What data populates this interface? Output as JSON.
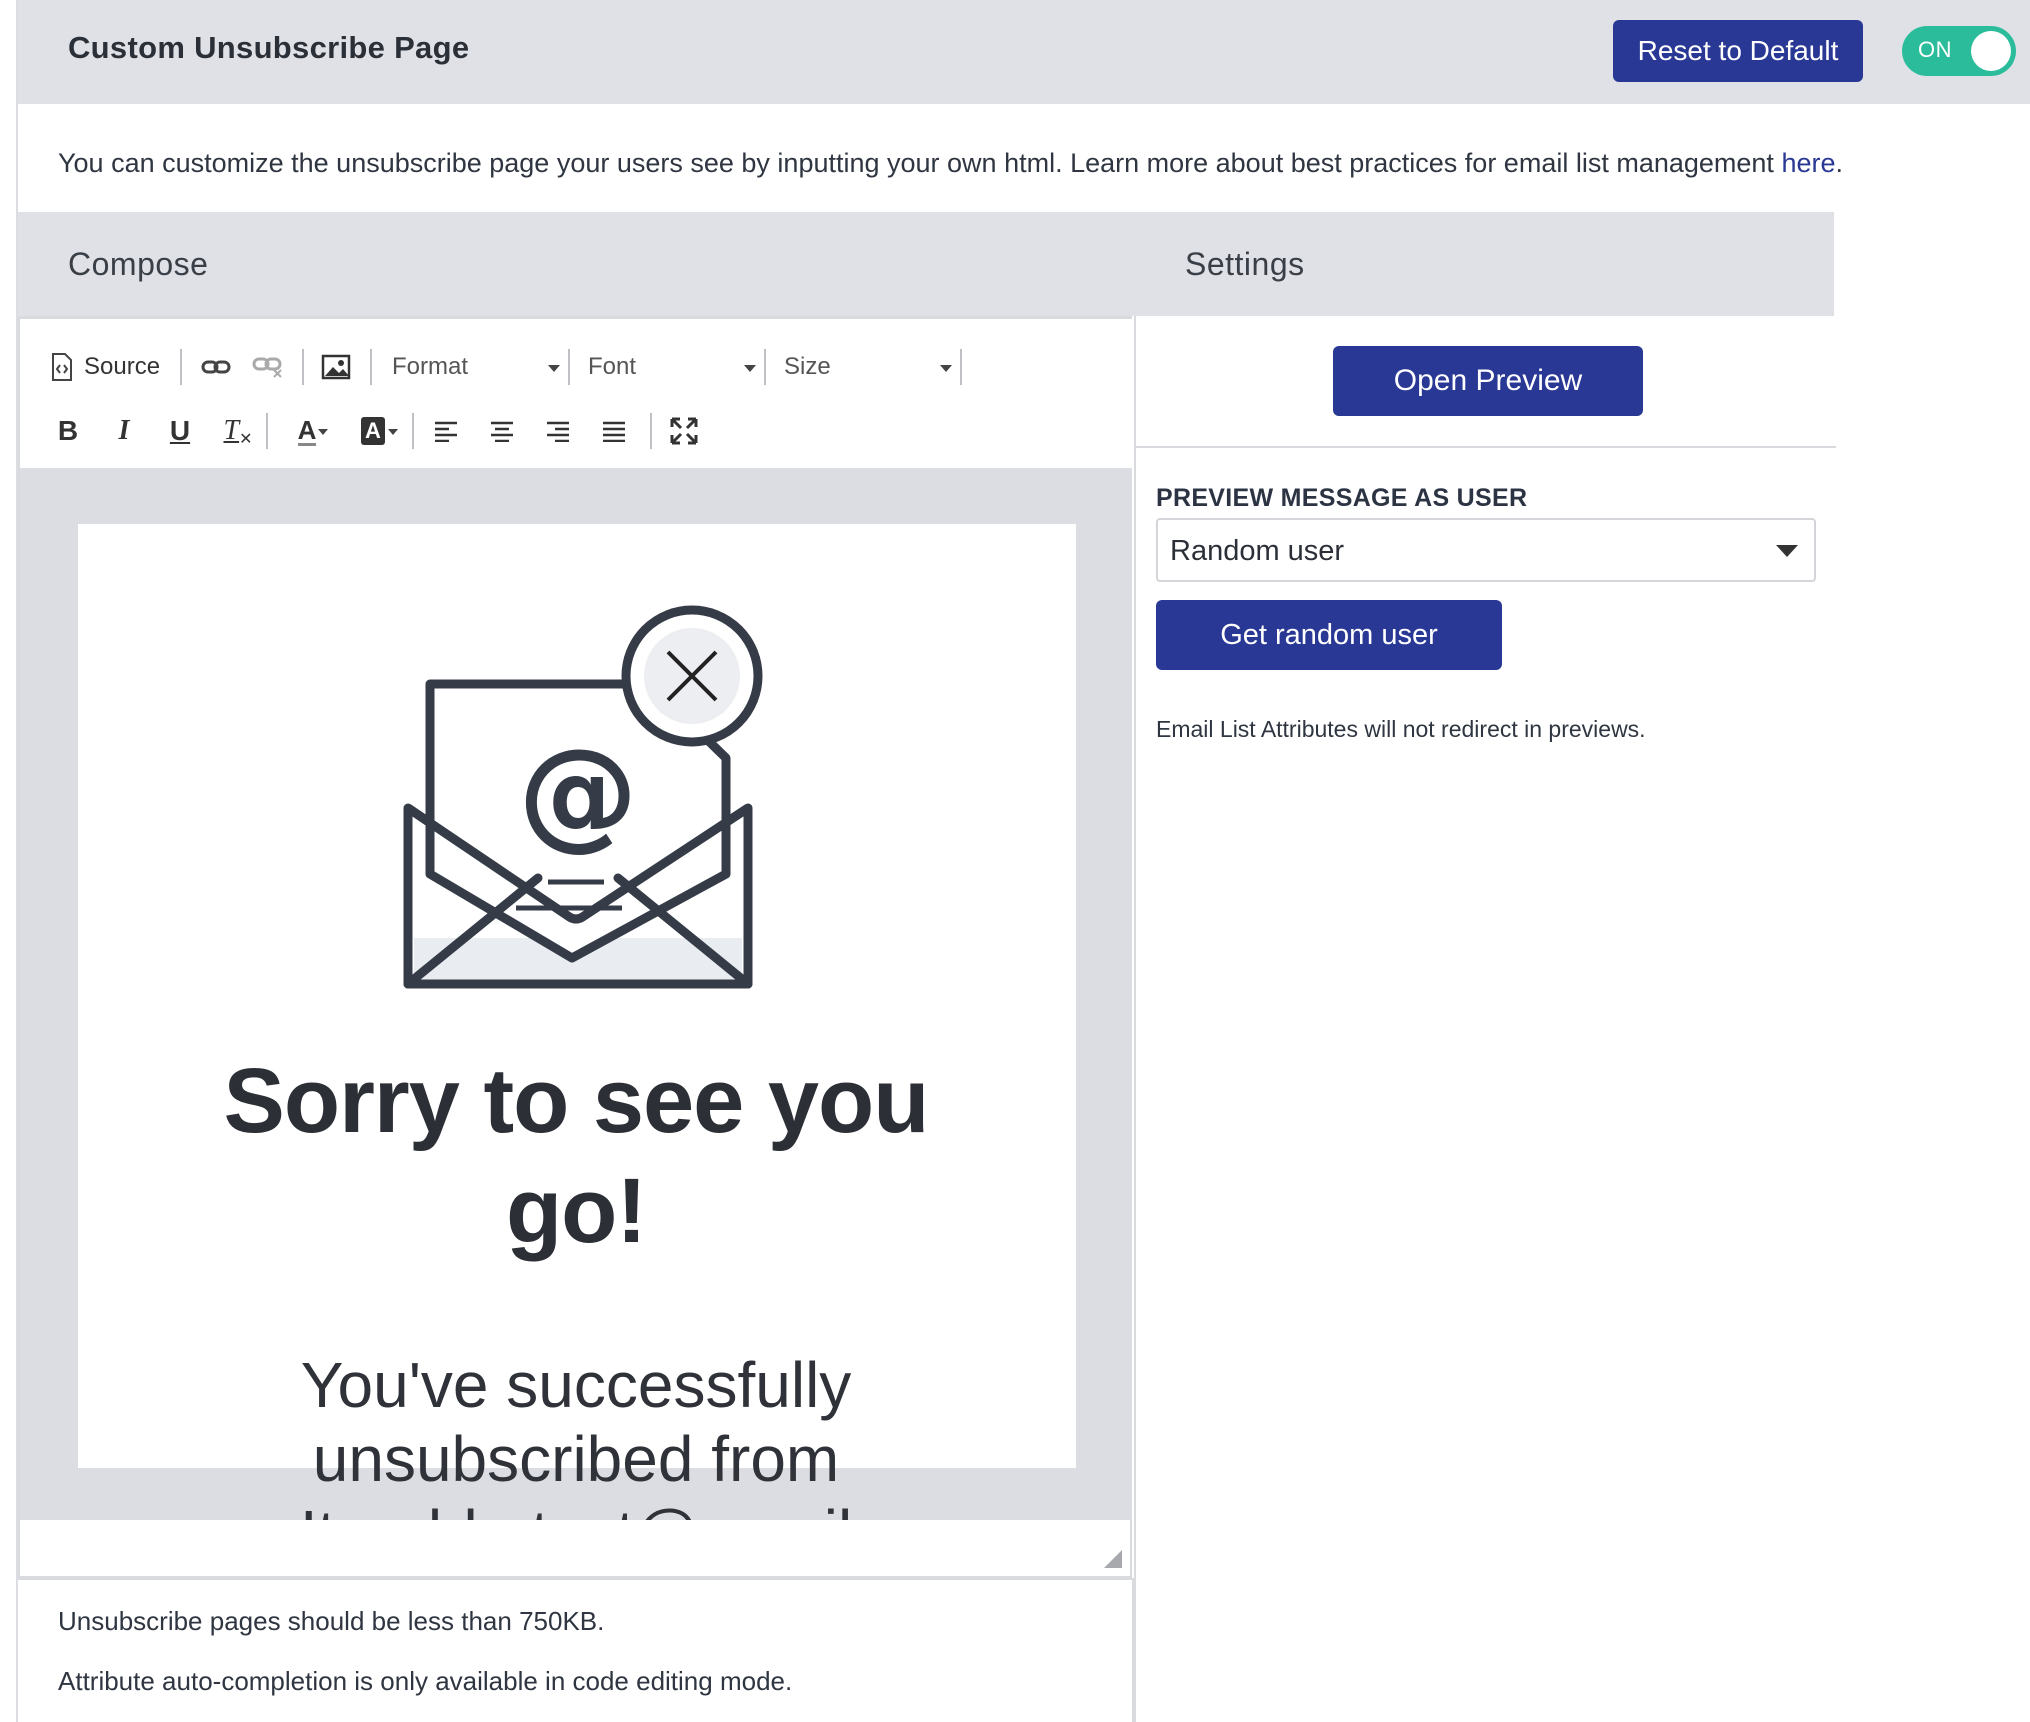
{
  "header": {
    "title": "Custom Unsubscribe Page",
    "reset_label": "Reset to Default",
    "toggle_label": "ON"
  },
  "intro": {
    "text": "You can customize the unsubscribe page your users see by inputting your own html. Learn more about best practices for email list management ",
    "link": "here",
    "end": "."
  },
  "tabs": {
    "compose": "Compose",
    "settings": "Settings"
  },
  "toolbar": {
    "source": "Source",
    "format": "Format",
    "font": "Font",
    "size": "Size",
    "icons": [
      "source-icon",
      "link-icon",
      "unlink-icon",
      "image-icon",
      "bold-icon",
      "italic-icon",
      "underline-icon",
      "remove-format-icon",
      "text-color-icon",
      "background-color-icon",
      "align-left-icon",
      "align-center-icon",
      "align-right-icon",
      "justify-icon",
      "maximize-icon"
    ],
    "bold": "B",
    "italic": "I",
    "underline": "U",
    "clear": "T",
    "textcolor": "A",
    "bgcolor": "A"
  },
  "content": {
    "headline_line1": "Sorry to see you",
    "headline_line2": "go!",
    "sub_line1": "You've successfully",
    "sub_line2": "unsubscribed from",
    "sub_line3": "Iterable test@email"
  },
  "footer": {
    "size_note": "Unsubscribe pages should be less than 750KB.",
    "autocomplete_note": "Attribute auto-completion is only available in code editing mode."
  },
  "settings": {
    "open_preview": "Open Preview",
    "preview_label": "PREVIEW MESSAGE AS USER",
    "selected_user": "Random user",
    "get_random": "Get random user",
    "note": "Email List Attributes will not redirect in previews."
  },
  "colors": {
    "primary": "#293894",
    "toggle_on": "#2bbd9b",
    "header_bg": "#e0e1e6",
    "text": "#2f3641"
  }
}
